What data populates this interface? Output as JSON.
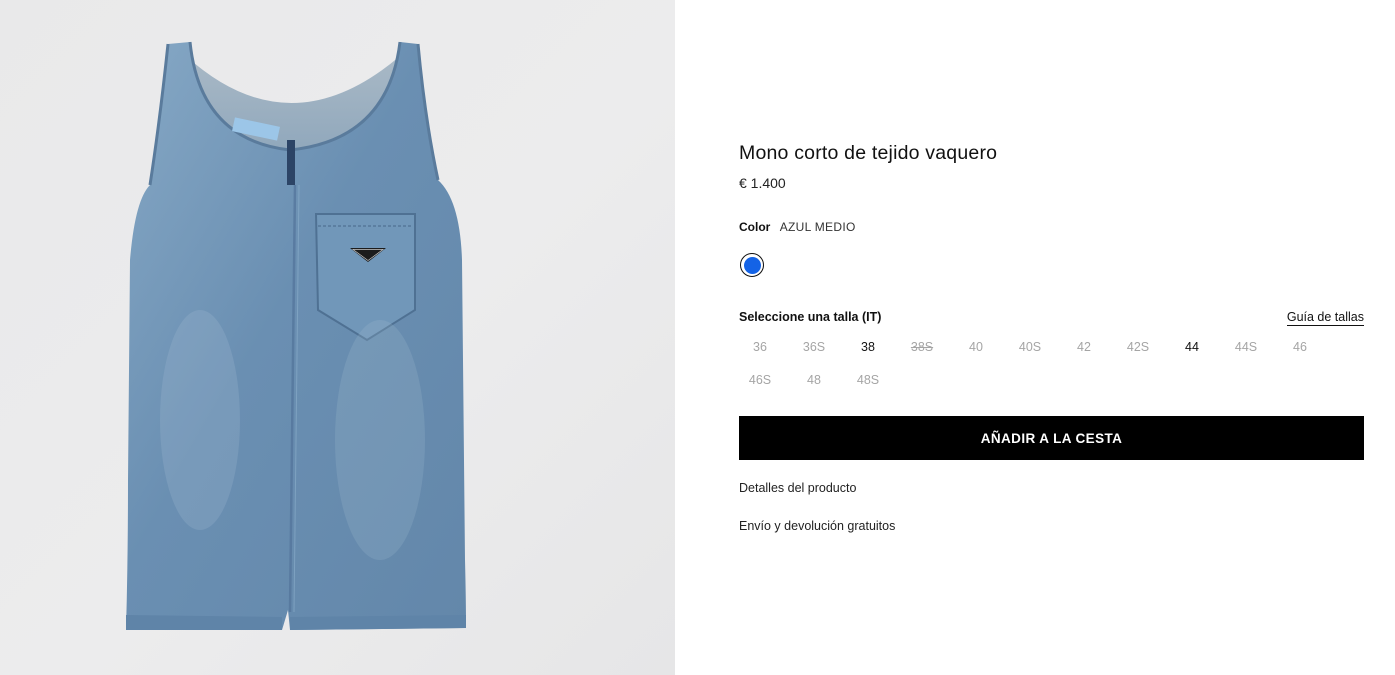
{
  "product": {
    "title": "Mono corto de tejido vaquero",
    "price": "€ 1.400",
    "color_label": "Color",
    "color_value": "AZUL MEDIO",
    "swatch_color": "#1463e6",
    "size_label": "Seleccione una talla (IT)",
    "size_guide": "Guía de tallas",
    "sizes": [
      {
        "label": "36",
        "available": false
      },
      {
        "label": "36S",
        "available": false
      },
      {
        "label": "38",
        "available": true
      },
      {
        "label": "38S",
        "available": false,
        "strike": true
      },
      {
        "label": "40",
        "available": false
      },
      {
        "label": "40S",
        "available": false
      },
      {
        "label": "42",
        "available": false
      },
      {
        "label": "42S",
        "available": false
      },
      {
        "label": "44",
        "available": true
      },
      {
        "label": "44S",
        "available": false
      },
      {
        "label": "46",
        "available": false
      },
      {
        "label": "46S",
        "available": false
      },
      {
        "label": "48",
        "available": false
      },
      {
        "label": "48S",
        "available": false
      }
    ],
    "add_to_cart": "AÑADIR A LA CESTA",
    "details_link": "Detalles del producto",
    "shipping_link": "Envío y devolución gratuitos"
  },
  "image": {
    "logo_text": "PRADA",
    "denim_color": "#6f93b4",
    "background_color": "#eaeaeb"
  }
}
